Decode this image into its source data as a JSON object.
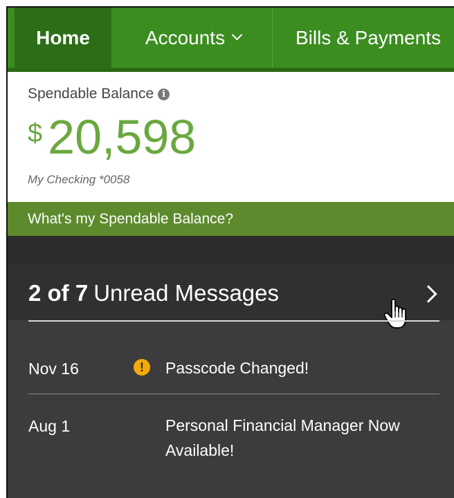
{
  "nav": {
    "home": "Home",
    "accounts": "Accounts",
    "bills": "Bills & Payments"
  },
  "balance": {
    "label": "Spendable Balance",
    "currency": "$",
    "amount": "20,598",
    "account": "My Checking *0058"
  },
  "spendable_link": "What's my Spendable Balance?",
  "messages": {
    "count_label": "2 of 7",
    "title": "Unread Messages",
    "items": [
      {
        "date": "Nov 16",
        "text": "Passcode Changed!",
        "alert": true
      },
      {
        "date": "Aug 1",
        "text": "Personal Financial Manager Now Available!",
        "alert": false
      }
    ]
  },
  "colors": {
    "nav_green": "#3b8d20",
    "nav_active": "#2b6e17",
    "balance_green": "#6aa83f",
    "link_bar": "#5d8a2c",
    "alert": "#f4a90a"
  },
  "icons": [
    "chevron-down-icon",
    "info-icon",
    "chevron-right-icon",
    "alert-icon",
    "hand-cursor-icon"
  ]
}
